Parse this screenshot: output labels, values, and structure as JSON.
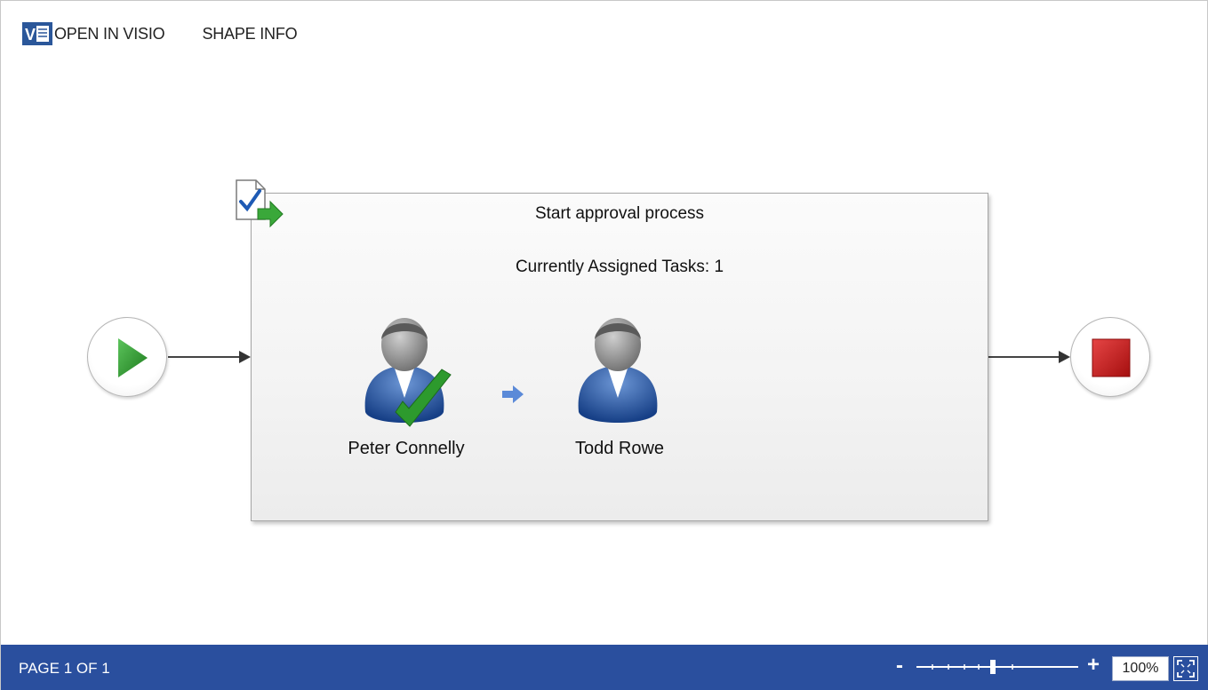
{
  "toolbar": {
    "open_in_visio": "OPEN IN VISIO",
    "shape_info": "SHAPE INFO",
    "visio_logo_icon": "visio-logo-icon"
  },
  "diagram": {
    "start_icon": "play-icon",
    "end_icon": "stop-icon",
    "stage": {
      "title": "Start approval process",
      "assigned_tasks": "Currently Assigned Tasks: 1",
      "icon": "approval-stage-icon",
      "assignees": [
        {
          "name": "Peter Connelly",
          "icon": "user-icon",
          "status": "completed"
        },
        {
          "name": "Todd Rowe",
          "icon": "user-icon",
          "status": "pending"
        }
      ]
    }
  },
  "statusbar": {
    "page_label": "PAGE 1 OF 1",
    "zoom_minus": "-",
    "zoom_plus": "+",
    "zoom_level": "100%"
  },
  "colors": {
    "statusbar": "#2a4f9e",
    "play": "#2e8b2e",
    "stop": "#c21a1a",
    "check": "#3aa83a",
    "user_body": "#1f4f9a",
    "user_head": "#8a8a8a"
  }
}
